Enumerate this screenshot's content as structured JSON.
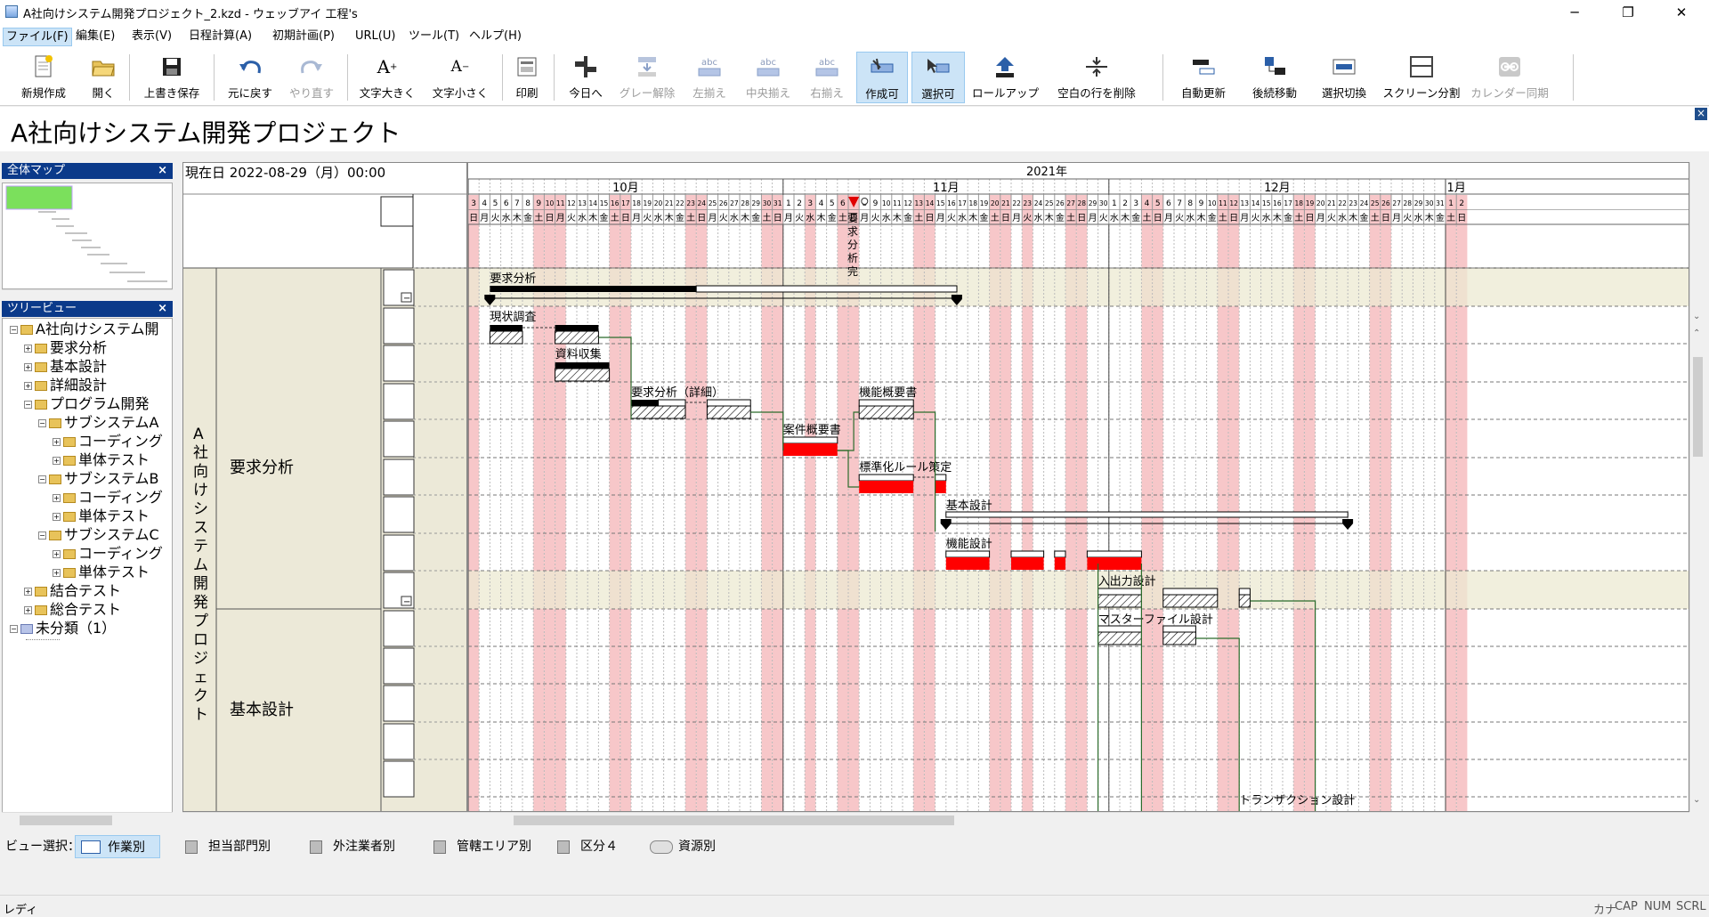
{
  "window": {
    "title": "A社向けシステム開発プロジェクト_2.kzd - ウェッブアイ 工程's",
    "minimize": "─",
    "restore": "❐",
    "close": "✕"
  },
  "menu": [
    "ファイル(F)",
    "編集(E)",
    "表示(V)",
    "日程計算(A)",
    "初期計画(P)",
    "URL(U)",
    "ツール(T)",
    "ヘルプ(H)"
  ],
  "toolbar": {
    "new": "新規作成",
    "open": "開く",
    "save": "上書き保存",
    "undo": "元に戻す",
    "redo": "やり直す",
    "font_up": "文字大きく",
    "font_down": "文字小さく",
    "print": "印刷",
    "today": "今日へ",
    "gray_off": "グレー解除",
    "align_left": "左揃え",
    "align_center": "中央揃え",
    "align_right": "右揃え",
    "create_on": "作成可",
    "select_on": "選択可",
    "rollup": "ロールアップ",
    "delete_blank": "空白の行を削除",
    "auto_update": "自動更新",
    "follow_move": "後続移動",
    "select_switch": "選択切換",
    "screen_split": "スクリーン分割",
    "calendar_sync": "カレンダー同期",
    "abc": "abc"
  },
  "project_title": "A社向けシステム開発プロジェクト",
  "map_panel": {
    "title": "全体マップ",
    "close": "×"
  },
  "tree_panel": {
    "title": "ツリービュー",
    "close": "×"
  },
  "tree": [
    {
      "label": "A社向けシステム開",
      "level": 0,
      "pm": "−"
    },
    {
      "label": "要求分析",
      "level": 1,
      "pm": "+"
    },
    {
      "label": "基本設計",
      "level": 1,
      "pm": "+"
    },
    {
      "label": "詳細設計",
      "level": 1,
      "pm": "+"
    },
    {
      "label": "プログラム開発",
      "level": 1,
      "pm": "−"
    },
    {
      "label": "サブシステムA",
      "level": 2,
      "pm": "−"
    },
    {
      "label": "コーディング",
      "level": 3,
      "pm": "+"
    },
    {
      "label": "単体テスト",
      "level": 3,
      "pm": "+"
    },
    {
      "label": "サブシステムB",
      "level": 2,
      "pm": "−"
    },
    {
      "label": "コーディング",
      "level": 3,
      "pm": "+"
    },
    {
      "label": "単体テスト",
      "level": 3,
      "pm": "+"
    },
    {
      "label": "サブシステムC",
      "level": 2,
      "pm": "−"
    },
    {
      "label": "コーディング",
      "level": 3,
      "pm": "+"
    },
    {
      "label": "単体テスト",
      "level": 3,
      "pm": "+"
    },
    {
      "label": "結合テスト",
      "level": 1,
      "pm": "+"
    },
    {
      "label": "総合テスト",
      "level": 1,
      "pm": "+"
    },
    {
      "label": "未分類（1）",
      "level": 0,
      "pm": "−"
    }
  ],
  "now_date": "現在日 2022-08-29（月）00:00",
  "gantt": {
    "project_label": "A社向けシステム開発プロジェクト",
    "groups": [
      "要求分析",
      "基本設計"
    ],
    "year": "2021年",
    "months": [
      "10月",
      "11月",
      "12月",
      "1月"
    ],
    "milestone_label": "要求分析完",
    "tasks": [
      "要求分析",
      "現状調査",
      "資料収集",
      "要求分析（詳細）",
      "機能概要書",
      "案件概要書",
      "標準化ルール策定",
      "基本設計",
      "機能設計",
      "入出力設計",
      "マスターファイル設計",
      "トランザクション設計"
    ],
    "collapse_sign": "−"
  },
  "view_select": {
    "label": "ビュー選択：",
    "items": [
      "作業別",
      "担当部門別",
      "外注業者別",
      "管轄エリア別",
      "区分４",
      "資源別"
    ]
  },
  "status": {
    "text": "レディ",
    "indicators": [
      "カナ",
      "CAP",
      "NUM",
      "SCRL"
    ]
  }
}
